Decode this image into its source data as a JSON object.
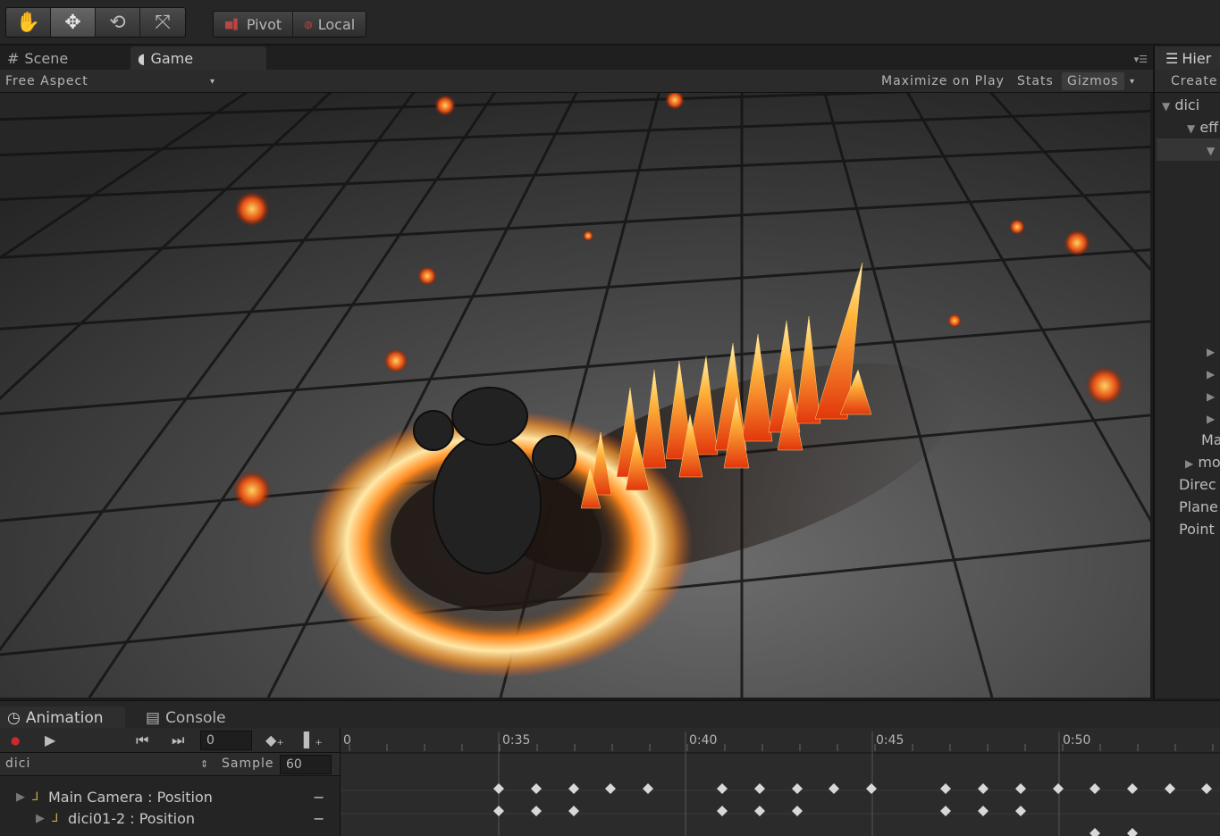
{
  "toolbar": {
    "transform_tools": [
      {
        "icon": "hand-icon",
        "glyph": "✋"
      },
      {
        "icon": "move-icon",
        "glyph": "✥"
      },
      {
        "icon": "rotate-icon",
        "glyph": "⟲"
      },
      {
        "icon": "scale-icon",
        "glyph": "⤧"
      }
    ],
    "active_tool": "move",
    "pivot_label": "Pivot",
    "local_label": "Local"
  },
  "view_tabs": {
    "scene_label": "Scene",
    "game_label": "Game",
    "active": "Game"
  },
  "game_bar": {
    "aspect_label": "Free Aspect",
    "maximize_label": "Maximize on Play",
    "stats_label": "Stats",
    "gizmos_label": "Gizmos"
  },
  "hierarchy": {
    "tab_label": "Hier",
    "create_label": "Create",
    "items": [
      {
        "label": "dici",
        "arrow": "▼"
      },
      {
        "label": "eff",
        "arrow": "▼"
      },
      {
        "label": "",
        "arrow": "▼"
      },
      {
        "label": "",
        "arrow": "▶"
      },
      {
        "label": "",
        "arrow": "▶"
      },
      {
        "label": "",
        "arrow": "▶"
      },
      {
        "label": "",
        "arrow": "▶"
      },
      {
        "label": "Ma",
        "arrow": ""
      },
      {
        "label": "mo",
        "arrow": "▶"
      },
      {
        "label": "Direc",
        "arrow": ""
      },
      {
        "label": "Plane",
        "arrow": ""
      },
      {
        "label": "Point",
        "arrow": ""
      }
    ]
  },
  "bottom_tabs": {
    "animation_label": "Animation",
    "console_label": "Console",
    "active": "Animation"
  },
  "animation": {
    "frame_value": "0",
    "clip_name": "dici",
    "sample_label": "Sample",
    "sample_value": "60",
    "timeline_start": "0",
    "time_marks": [
      "0:35",
      "0:40",
      "0:45",
      "0:50"
    ],
    "properties": [
      {
        "label": "Main Camera : Position",
        "minus": "−"
      },
      {
        "label": "dici01-2 : Position",
        "minus": "−"
      }
    ]
  },
  "colors": {
    "record_red": "#cc2a2a",
    "panel_bg": "#262626",
    "fire_core": "#ffd27a",
    "fire_outer": "#ff5a12"
  }
}
